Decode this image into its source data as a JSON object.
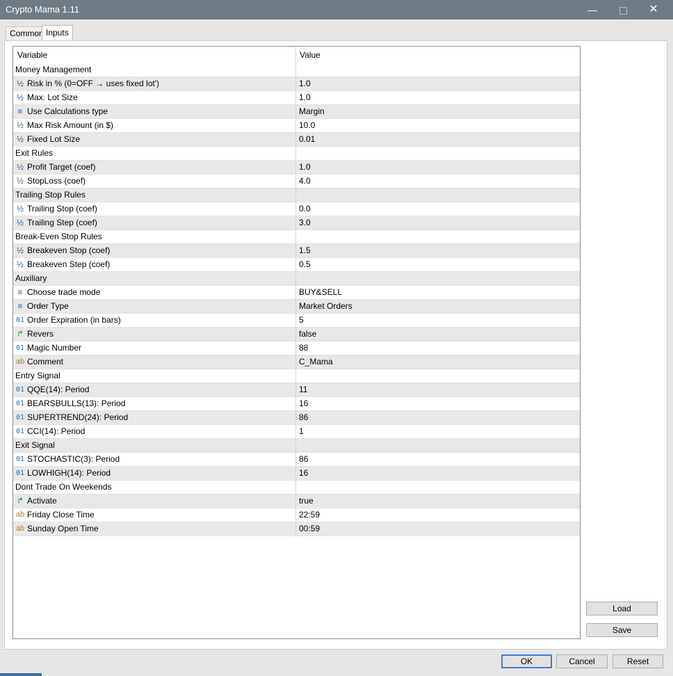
{
  "window": {
    "title": "Crypto Mama 1.11",
    "minimize": "—",
    "close": "✕"
  },
  "tabs": [
    {
      "label": "Common"
    },
    {
      "label": "Inputs"
    }
  ],
  "grid": {
    "columns": [
      "Variable",
      "Value"
    ],
    "rows": [
      {
        "icon": "",
        "variable": "Money Management",
        "value": ""
      },
      {
        "icon": "½",
        "variable": "Risk in % (0=OFF → uses fixed lot')",
        "value": "1.0"
      },
      {
        "icon": "½",
        "variable": "Max. Lot Size",
        "value": "1.0"
      },
      {
        "icon": "≡",
        "variable": "Use Calculations type",
        "value": "Margin"
      },
      {
        "icon": "½",
        "variable": "Max Risk Amount (in $)",
        "value": "10.0"
      },
      {
        "icon": "½",
        "variable": "Fixed Lot Size",
        "value": "0.01"
      },
      {
        "icon": "",
        "variable": "Exit Rules",
        "value": ""
      },
      {
        "icon": "½",
        "variable": "Profit Target (coef)",
        "value": "1.0"
      },
      {
        "icon": "½",
        "variable": "StopLoss (coef)",
        "value": "4.0"
      },
      {
        "icon": "",
        "variable": "Trailing Stop Rules",
        "value": ""
      },
      {
        "icon": "½",
        "variable": "Trailing Stop (coef)",
        "value": "0.0"
      },
      {
        "icon": "½",
        "variable": "Trailing Step (coef)",
        "value": "3.0"
      },
      {
        "icon": "",
        "variable": "Break-Even Stop Rules",
        "value": ""
      },
      {
        "icon": "½",
        "variable": "Breakeven Stop (coef)",
        "value": "1.5"
      },
      {
        "icon": "½",
        "variable": "Breakeven Step (coef)",
        "value": "0.5"
      },
      {
        "icon": "",
        "variable": "Auxiliary",
        "value": ""
      },
      {
        "icon": "≡",
        "variable": "Choose trade mode",
        "value": "BUY&SELL"
      },
      {
        "icon": "≡",
        "variable": "Order Type",
        "value": "Market Orders"
      },
      {
        "icon": "01",
        "variable": "Order Expiration (in bars)",
        "value": "5"
      },
      {
        "icon": "↱",
        "variable": "Revers",
        "value": "false"
      },
      {
        "icon": "01",
        "variable": "Magic Number",
        "value": "88"
      },
      {
        "icon": "ab",
        "variable": "Comment",
        "value": "C_Mama"
      },
      {
        "icon": "",
        "variable": "Entry Signal",
        "value": ""
      },
      {
        "icon": "01",
        "variable": "QQE(14): Period",
        "value": "11"
      },
      {
        "icon": "01",
        "variable": "BEARSBULLS(13): Period",
        "value": "16"
      },
      {
        "icon": "01",
        "variable": "SUPERTREND(24): Period",
        "value": "86"
      },
      {
        "icon": "01",
        "variable": "CCI(14):   Period",
        "value": "1"
      },
      {
        "icon": "",
        "variable": "Exit Signal",
        "value": ""
      },
      {
        "icon": "01",
        "variable": "STOCHASTIC(3): Period",
        "value": "86"
      },
      {
        "icon": "01",
        "variable": "LOWHIGH(14): Period",
        "value": "16"
      },
      {
        "icon": "",
        "variable": "Dont Trade On Weekends",
        "value": ""
      },
      {
        "icon": "↱",
        "variable": "Activate",
        "value": "true"
      },
      {
        "icon": "ab",
        "variable": "Friday Close Time",
        "value": "22:59"
      },
      {
        "icon": "ab",
        "variable": "Sunday Open Time",
        "value": "00:59"
      }
    ]
  },
  "buttons": {
    "load": "Load",
    "save": "Save",
    "ok": "OK",
    "cancel": "Cancel",
    "reset": "Reset"
  }
}
